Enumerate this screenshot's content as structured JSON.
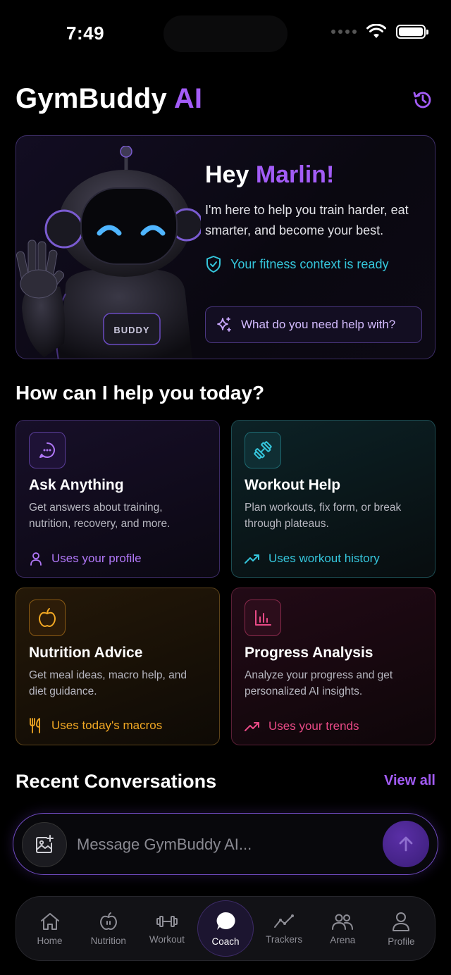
{
  "status_bar": {
    "time": "7:49"
  },
  "header": {
    "title_main": "GymBuddy",
    "title_accent": "AI"
  },
  "hero": {
    "greeting_prefix": "Hey",
    "greeting_name": "Marlin!",
    "description": "I'm here to help you train harder, eat smarter, and become your best.",
    "context_status": "Your fitness context is ready",
    "help_button_label": "What do you need help with?",
    "robot_badge": "BUDDY"
  },
  "section_title": "How can I help you today?",
  "cards": {
    "ask": {
      "title": "Ask Anything",
      "description": "Get answers about training, nutrition, recovery, and more.",
      "tag": "Uses your profile"
    },
    "workout": {
      "title": "Workout Help",
      "description": "Plan workouts, fix form, or break through plateaus.",
      "tag": "Uses workout history"
    },
    "nutrition": {
      "title": "Nutrition Advice",
      "description": "Get meal ideas, macro help, and diet guidance.",
      "tag": "Uses today's macros"
    },
    "progress": {
      "title": "Progress Analysis",
      "description": "Analyze your progress and get personalized AI insights.",
      "tag": "Uses your trends"
    }
  },
  "recent": {
    "title": "Recent Conversations",
    "view_all": "View all"
  },
  "composer": {
    "placeholder": "Message GymBuddy AI..."
  },
  "tabs": [
    {
      "label": "Home",
      "icon": "home-icon"
    },
    {
      "label": "Nutrition",
      "icon": "apple-icon"
    },
    {
      "label": "Workout",
      "icon": "dumbbell-icon"
    },
    {
      "label": "Coach",
      "icon": "chat-bubble-icon",
      "active": true
    },
    {
      "label": "Trackers",
      "icon": "trend-line-icon"
    },
    {
      "label": "Arena",
      "icon": "group-icon"
    },
    {
      "label": "Profile",
      "icon": "person-icon"
    }
  ],
  "colors": {
    "accent_purple": "#a35cf7",
    "cyan": "#35c6dc",
    "orange": "#f1a824",
    "pink": "#e94a86",
    "background": "#000000"
  }
}
